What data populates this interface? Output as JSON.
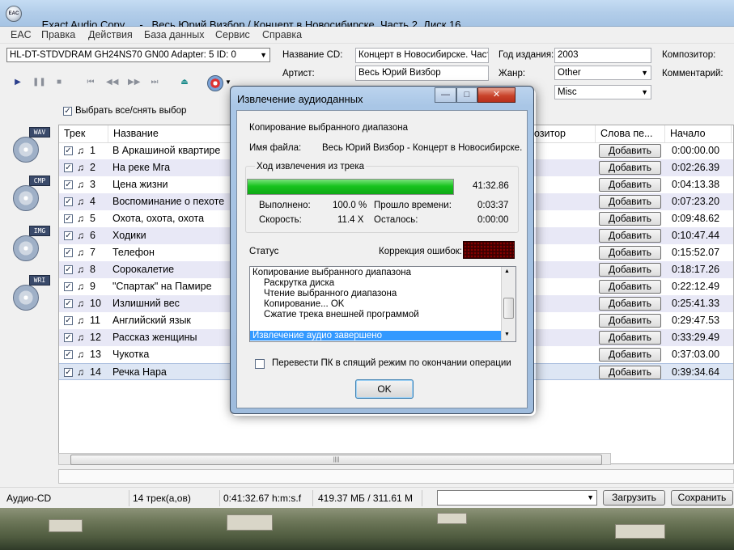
{
  "window": {
    "app_name": "Exact Audio Copy",
    "dash": "-",
    "title": "Весь Юрий Визбор / Концерт в Новосибирске. Часть 2. Диск 16",
    "app_icon_text": "EAC"
  },
  "menu": [
    "EAC",
    "Правка",
    "Действия",
    "База данных",
    "Сервис",
    "Справка"
  ],
  "drive": {
    "selected": "HL-DT-STDVDRAM GH24NS70 GN00   Adapter: 5  ID: 0"
  },
  "cd_info": {
    "cd_name_label": "Название CD:",
    "cd_name_value": "Концерт в Новосибирске. Част",
    "artist_label": "Артист:",
    "artist_value": "Весь Юрий Визбор",
    "year_label": "Год издания:",
    "year_value": "2003",
    "genre_label": "Жанр:",
    "genre_value": "Other",
    "genre_misc": "Misc",
    "composer_label": "Композитор:",
    "comment_label": "Комментарий:"
  },
  "toolbar": {
    "play": "▶",
    "pause": "❚❚",
    "stop": "■",
    "first": "⏮",
    "prev": "◀◀",
    "next": "▶▶",
    "last": "⏭",
    "eject": "⏏",
    "select_all_label": "Выбрать все/снять выбор"
  },
  "sidebar": [
    {
      "tag": "WAV",
      "icon": "wav-disc-icon"
    },
    {
      "tag": "CMP",
      "icon": "cmp-disc-icon"
    },
    {
      "tag": "IMG",
      "icon": "img-disc-icon"
    },
    {
      "tag": "WRI",
      "icon": "wri-disc-icon"
    }
  ],
  "table": {
    "headers": {
      "track": "Трек",
      "title": "Название",
      "composer": "озитор",
      "lyrics": "Слова пе...",
      "start": "Начало"
    },
    "add_label": "Добавить",
    "rows": [
      {
        "num": "1",
        "title": "В Аркашиной квартире",
        "start": "0:00:00.00"
      },
      {
        "num": "2",
        "title": "На реке Мга",
        "start": "0:02:26.39"
      },
      {
        "num": "3",
        "title": "Цена жизни",
        "start": "0:04:13.38"
      },
      {
        "num": "4",
        "title": "Воспоминание о пехоте",
        "start": "0:07:23.20"
      },
      {
        "num": "5",
        "title": "Охота, охота, охота",
        "start": "0:09:48.62"
      },
      {
        "num": "6",
        "title": "Ходики",
        "start": "0:10:47.44"
      },
      {
        "num": "7",
        "title": "Телефон",
        "start": "0:15:52.07"
      },
      {
        "num": "8",
        "title": "Сорокалетие",
        "start": "0:18:17.26"
      },
      {
        "num": "9",
        "title": "\"Спартак\" на Памире",
        "start": "0:22:12.49"
      },
      {
        "num": "10",
        "title": "Излишний вес",
        "start": "0:25:41.33"
      },
      {
        "num": "11",
        "title": "Английский язык",
        "start": "0:29:47.53"
      },
      {
        "num": "12",
        "title": "Рассказ женщины",
        "start": "0:33:29.49"
      },
      {
        "num": "13",
        "title": "Чукотка",
        "start": "0:37:03.00"
      },
      {
        "num": "14",
        "title": "Речка Нара",
        "start": "0:39:34.64"
      }
    ]
  },
  "status_bar": {
    "mode": "Аудио-CD",
    "tracks": "14 трек(а,ов)",
    "length": "0:41:32.67  h:m:s.f",
    "size": "419.37 МБ / 311.61 М",
    "load_button": "Загрузить",
    "save_button": "Сохранить"
  },
  "dialog": {
    "title": "Извлечение аудиоданных",
    "heading": "Копирование выбранного диапазона",
    "filename_label": "Имя файла:",
    "filename_value": "Весь Юрий Визбор - Концерт в Новосибирске.",
    "progress_group_label": "Ход извлечения из трека",
    "progress_time": "41:32.86",
    "progress_fraction": 1.0,
    "done_label": "Выполнено:",
    "done_value": "100.0 %",
    "elapsed_label": "Прошло времени:",
    "elapsed_value": "0:03:37",
    "speed_label": "Скорость:",
    "speed_value": "11.4 X",
    "remaining_label": "Осталось:",
    "remaining_value": "0:00:00",
    "status_label": "Статус",
    "error_correction_label": "Коррекция ошибок:",
    "log": [
      "Копирование выбранного диапазона",
      "Раскрутка диска",
      "Чтение выбранного диапазона",
      "Копирование... OK",
      "Сжатие трека внешней программой"
    ],
    "log_selected": "Извлечение аудио завершено",
    "sleep_label": "Перевести ПК в спящий режим по окончании операции",
    "ok_label": "OK",
    "minimize": "—",
    "maximize": "□",
    "close": "✕"
  }
}
